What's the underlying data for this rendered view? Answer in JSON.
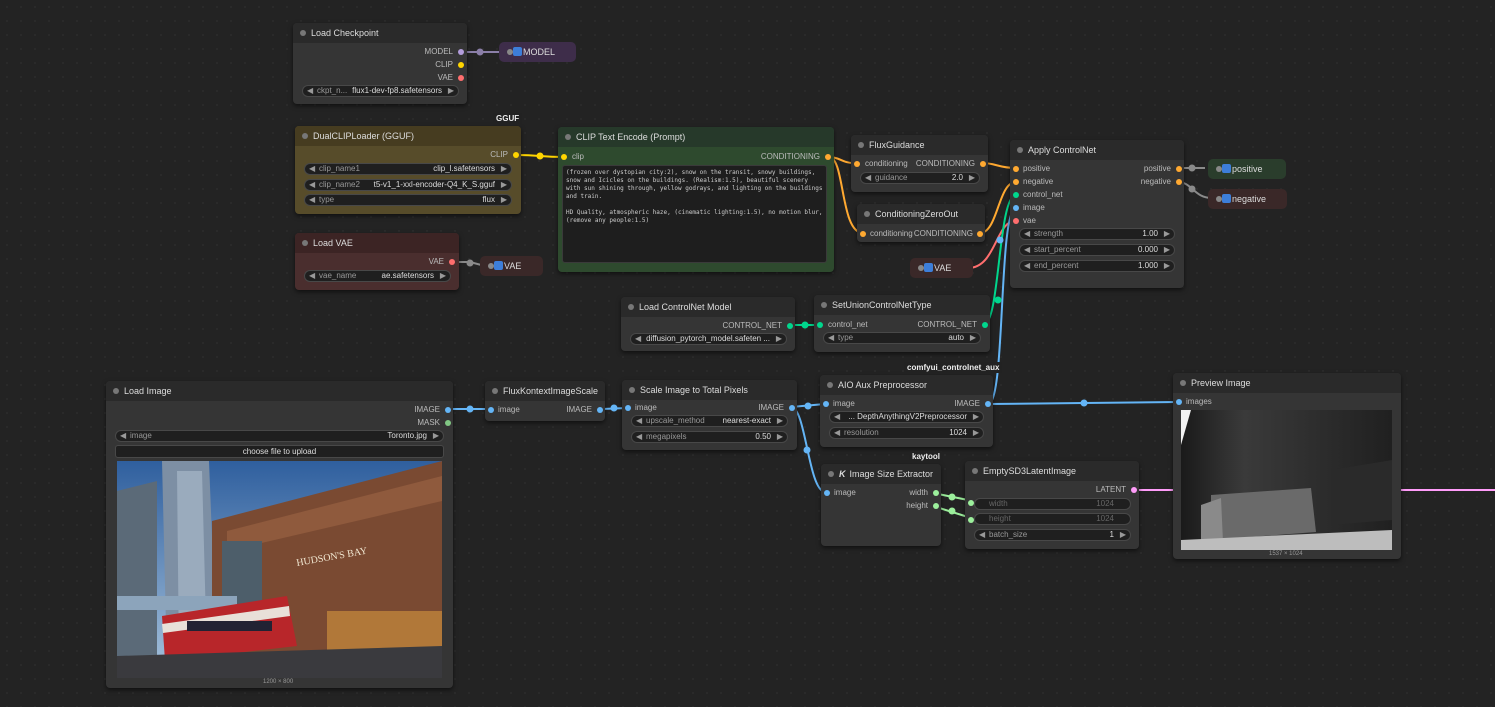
{
  "colors": {
    "model": "#b39ddb",
    "clip": "#ffd500",
    "vae": "#ff6e6e",
    "conditioning": "#ffa931",
    "image": "#64b5f6",
    "mask": "#81c784",
    "control_net": "#00d78d",
    "int": "#9cef9c",
    "latent": "#ff9cf9",
    "canvas": "#232323",
    "node": "#353535"
  },
  "load_checkpoint": {
    "title": "Load Checkpoint",
    "out_model": "MODEL",
    "out_clip": "CLIP",
    "out_vae": "VAE",
    "ckpt_label": "ckpt_n...",
    "ckpt_value": "flux1-dev-fp8.safetensors"
  },
  "reroute_model": {
    "label": "MODEL"
  },
  "gguf_tag": "GGUF",
  "dual_clip": {
    "title": "DualCLIPLoader (GGUF)",
    "out_clip": "CLIP",
    "clip1_label": "clip_name1",
    "clip1_value": "clip_l.safetensors",
    "clip2_label": "clip_name2",
    "clip2_value": "t5-v1_1-xxl-encoder-Q4_K_S.gguf",
    "type_label": "type",
    "type_value": "flux"
  },
  "load_vae": {
    "title": "Load VAE",
    "out_vae": "VAE",
    "name_label": "vae_name",
    "name_value": "ae.safetensors"
  },
  "reroute_vae": {
    "label": "VAE"
  },
  "clip_text": {
    "title": "CLIP Text Encode (Prompt)",
    "in_clip": "clip",
    "out": "CONDITIONING",
    "text": "(frozen over dystopian city:2), snow on the transit, snowy buildings, snow and Icicles on the buildings. (Realism:1.5), beautiful scenery with sun shining through, yellow godrays, and lighting on the buildings and train.\n\nHD Quality, atmospheric haze, (cinematic lighting:1.5), no motion blur, (remove any people:1.5)"
  },
  "flux_guidance": {
    "title": "FluxGuidance",
    "in": "conditioning",
    "out": "CONDITIONING",
    "g_label": "guidance",
    "g_value": "2.0"
  },
  "cond_zero": {
    "title": "ConditioningZeroOut",
    "in": "conditioning",
    "out": "CONDITIONING"
  },
  "apply_cn": {
    "title": "Apply ControlNet",
    "in_pos": "positive",
    "in_neg": "negative",
    "in_cn": "control_net",
    "in_img": "image",
    "in_vae": "vae",
    "out_pos": "positive",
    "out_neg": "negative",
    "strength_label": "strength",
    "strength_value": "1.00",
    "start_label": "start_percent",
    "start_value": "0.000",
    "end_label": "end_percent",
    "end_value": "1.000"
  },
  "reroute_pos": {
    "label": "positive"
  },
  "reroute_neg": {
    "label": "negative"
  },
  "reroute_vae2": {
    "label": "VAE"
  },
  "load_cn_model": {
    "title": "Load ControlNet Model",
    "out": "CONTROL_NET",
    "value": "diffusion_pytorch_model.safeten ..."
  },
  "set_union": {
    "title": "SetUnionControlNetType",
    "in": "control_net",
    "out": "CONTROL_NET",
    "type_label": "type",
    "type_value": "auto"
  },
  "aux_tag": "comfyui_controlnet_aux",
  "load_image": {
    "title": "Load Image",
    "out_image": "IMAGE",
    "out_mask": "MASK",
    "image_label": "image",
    "image_value": "Toronto.jpg",
    "upload_label": "choose file to upload",
    "caption": "1200 × 800",
    "sign_text": "HUDSON'S BAY"
  },
  "flux_kontext": {
    "title": "FluxKontextImageScale",
    "in": "image",
    "out": "IMAGE"
  },
  "scale_total": {
    "title": "Scale Image to Total Pixels",
    "in": "image",
    "out": "IMAGE",
    "method_label": "upscale_method",
    "method_value": "nearest-exact",
    "mp_label": "megapixels",
    "mp_value": "0.50"
  },
  "aio_aux": {
    "title": "AIO Aux Preprocessor",
    "in": "image",
    "out": "IMAGE",
    "pre_value": "... DepthAnythingV2Preprocessor",
    "res_label": "resolution",
    "res_value": "1024"
  },
  "kaytool_tag": "kaytool",
  "size_extractor": {
    "title_k": "K",
    "title": "Image Size Extractor",
    "in": "image",
    "out_w": "width",
    "out_h": "height"
  },
  "empty_latent": {
    "title": "EmptySD3LatentImage",
    "out": "LATENT",
    "width_label": "width",
    "width_value": "1024",
    "height_label": "height",
    "height_value": "1024",
    "batch_label": "batch_size",
    "batch_value": "1"
  },
  "preview": {
    "title": "Preview Image",
    "in": "images",
    "caption": "1537 × 1024"
  }
}
